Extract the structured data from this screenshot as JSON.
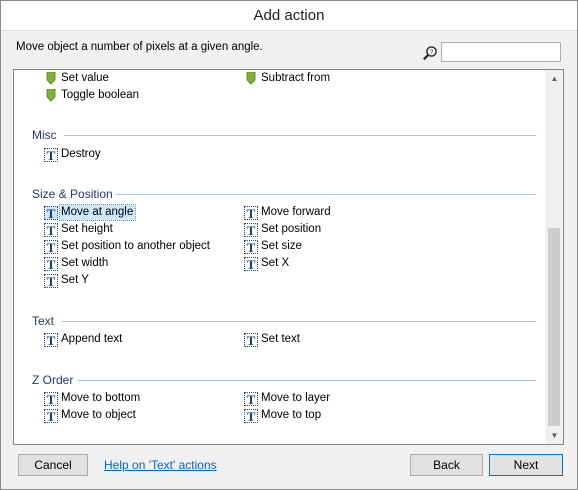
{
  "window": {
    "title": "Add action"
  },
  "header": {
    "description": "Move object a number of pixels at a given angle.",
    "search": {
      "value": "",
      "placeholder": ""
    }
  },
  "categories": [
    {
      "name": "",
      "icon": "green-marker-icon",
      "items": [
        "Set value",
        "Subtract from",
        "Toggle boolean"
      ]
    },
    {
      "name": "Misc",
      "icon": "text-t-icon",
      "items": [
        "Destroy"
      ]
    },
    {
      "name": "Size & Position",
      "icon": "text-t-icon",
      "items": [
        "Move at angle",
        "Move forward",
        "Set height",
        "Set position",
        "Set position to another object",
        "Set size",
        "Set width",
        "Set X",
        "Set Y"
      ],
      "selected": "Move at angle"
    },
    {
      "name": "Text",
      "icon": "text-t-icon",
      "items": [
        "Append text",
        "Set text"
      ]
    },
    {
      "name": "Z Order",
      "icon": "text-t-icon",
      "items": [
        "Move to bottom",
        "Move to layer",
        "Move to object",
        "Move to top"
      ]
    }
  ],
  "icon_glyph": "T",
  "footer": {
    "cancel": "Cancel",
    "help": "Help on 'Text' actions",
    "back": "Back",
    "next": "Next"
  },
  "colors": {
    "category_text": "#1e3b70",
    "selection": "#cce8ff",
    "link": "#0066cc",
    "marker_green": "#7ab53a"
  }
}
